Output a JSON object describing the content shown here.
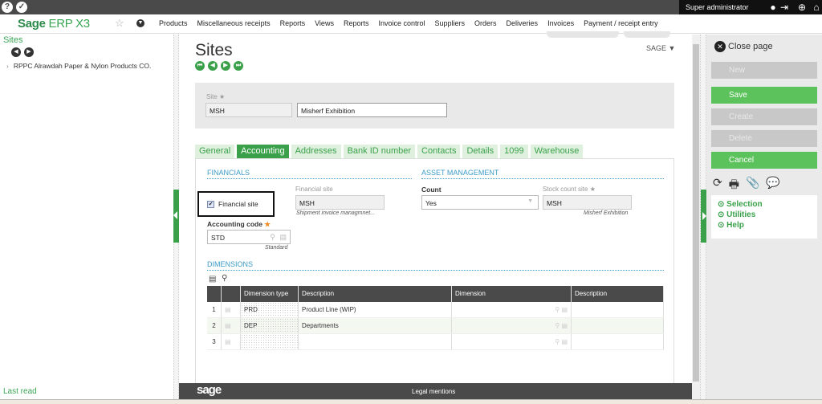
{
  "topbar": {
    "help_icon": "question-icon",
    "tools_icon": "wrench-icon",
    "user_name": "Super administrator"
  },
  "navbar": {
    "logo_brand": "Sage",
    "logo_product": "ERP X3",
    "menu": [
      "Products",
      "Miscellaneous receipts",
      "Reports",
      "Views",
      "Reports",
      "Invoice control",
      "Suppliers",
      "Orders",
      "Deliveries",
      "Invoices",
      "Payment / receipt entry"
    ]
  },
  "left_panel": {
    "title": "Sites",
    "tree_item": "RPPC Alrawdah Paper & Nylon Products CO.",
    "footer_link": "Last read"
  },
  "main": {
    "page_title": "Sites",
    "folder": "SAGE",
    "site_label": "Site",
    "site_code": "MSH",
    "site_name": "Misherf Exhibition",
    "tabs": [
      {
        "label": "General",
        "active": false
      },
      {
        "label": "Accounting",
        "active": true
      },
      {
        "label": "Addresses",
        "active": false
      },
      {
        "label": "Bank ID number",
        "active": false
      },
      {
        "label": "Contacts",
        "active": false
      },
      {
        "label": "Details",
        "active": false
      },
      {
        "label": "1099",
        "active": false
      },
      {
        "label": "Warehouse",
        "active": false
      }
    ],
    "financials": {
      "section_title": "FINANCIALS",
      "financial_site_checkbox_label": "Financial site",
      "financial_site_checked": true,
      "financial_site_field_label": "Financial site",
      "financial_site_value": "MSH",
      "financial_site_note": "Shipment invoice managmnet...",
      "accounting_code_label": "Accounting code",
      "accounting_code_value": "STD",
      "accounting_code_note": "Standard"
    },
    "asset_management": {
      "section_title": "ASSET MANAGEMENT",
      "count_label": "Count",
      "count_value": "Yes",
      "stock_count_site_label": "Stock count site",
      "stock_count_site_value": "MSH",
      "stock_count_site_note": "Misherf Exhibition"
    },
    "dimensions": {
      "section_title": "DIMENSIONS",
      "columns": [
        "",
        "",
        "Dimension type",
        "Description",
        "Dimension",
        "Description"
      ],
      "rows": [
        {
          "num": "1",
          "type": "PRD",
          "description": "Product Line (WIP)",
          "dimension": "",
          "dim_description": ""
        },
        {
          "num": "2",
          "type": "DEP",
          "description": "Departments",
          "dimension": "",
          "dim_description": ""
        },
        {
          "num": "3",
          "type": "",
          "description": "",
          "dimension": "",
          "dim_description": ""
        }
      ]
    }
  },
  "footer": {
    "logo": "sage",
    "legal": "Legal mentions"
  },
  "right_panel": {
    "close_label": "Close page",
    "buttons": [
      {
        "label": "New",
        "enabled": false
      },
      {
        "label": "Save",
        "enabled": true
      },
      {
        "label": "Create",
        "enabled": false
      },
      {
        "label": "Delete",
        "enabled": false
      },
      {
        "label": "Cancel",
        "enabled": true
      }
    ],
    "links": [
      "Selection",
      "Utilities",
      "Help"
    ]
  }
}
